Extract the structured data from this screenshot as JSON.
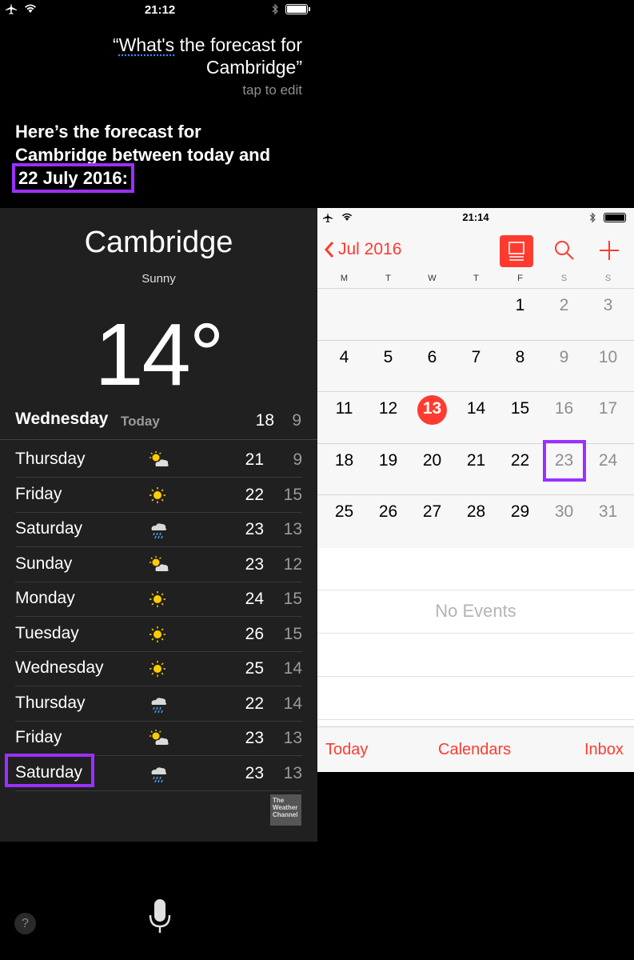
{
  "siri": {
    "status": {
      "time": "21:12"
    },
    "query_open": "“",
    "query_word": "What's",
    "query_rest": " the forecast for Cambridge”",
    "tap_to_edit": "tap to edit",
    "response_prefix": "Here’s the forecast for Cambridge between today and ",
    "response_date": "22 July 2016:"
  },
  "weather": {
    "city": "Cambridge",
    "condition": "Sunny",
    "temperature": "14°",
    "today": {
      "day": "Wednesday",
      "tag": "Today",
      "hi": "18",
      "lo": "9"
    },
    "days": [
      {
        "day": "Thursday",
        "icon": "partly-sunny-icon",
        "hi": "21",
        "lo": "9"
      },
      {
        "day": "Friday",
        "icon": "sun-icon",
        "hi": "22",
        "lo": "15"
      },
      {
        "day": "Saturday",
        "icon": "rain-icon",
        "hi": "23",
        "lo": "13"
      },
      {
        "day": "Sunday",
        "icon": "partly-sunny-icon",
        "hi": "23",
        "lo": "12"
      },
      {
        "day": "Monday",
        "icon": "sun-icon",
        "hi": "24",
        "lo": "15"
      },
      {
        "day": "Tuesday",
        "icon": "sun-icon",
        "hi": "26",
        "lo": "15"
      },
      {
        "day": "Wednesday",
        "icon": "sun-icon",
        "hi": "25",
        "lo": "14"
      },
      {
        "day": "Thursday",
        "icon": "rain-icon",
        "hi": "22",
        "lo": "14"
      },
      {
        "day": "Friday",
        "icon": "partly-sunny-icon",
        "hi": "23",
        "lo": "13"
      },
      {
        "day": "Saturday",
        "icon": "rain-icon",
        "hi": "23",
        "lo": "13"
      }
    ],
    "provider_logo": "The Weather Channel"
  },
  "calendar": {
    "status_time": "21:14",
    "month_label": "Jul 2016",
    "weekdays": [
      "M",
      "T",
      "W",
      "T",
      "F",
      "S",
      "S"
    ],
    "weeks": [
      [
        "",
        "",
        "",
        "",
        "1",
        "2",
        "3"
      ],
      [
        "4",
        "5",
        "6",
        "7",
        "8",
        "9",
        "10"
      ],
      [
        "11",
        "12",
        "13",
        "14",
        "15",
        "16",
        "17"
      ],
      [
        "18",
        "19",
        "20",
        "21",
        "22",
        "23",
        "24"
      ],
      [
        "25",
        "26",
        "27",
        "28",
        "29",
        "30",
        "31"
      ]
    ],
    "today": "13",
    "highlighted": "23",
    "no_events": "No Events",
    "tabs": {
      "today": "Today",
      "calendars": "Calendars",
      "inbox": "Inbox"
    }
  },
  "colors": {
    "accent": "#ff3b30",
    "highlight": "#9b30ff",
    "weather_bg": "#202021"
  }
}
